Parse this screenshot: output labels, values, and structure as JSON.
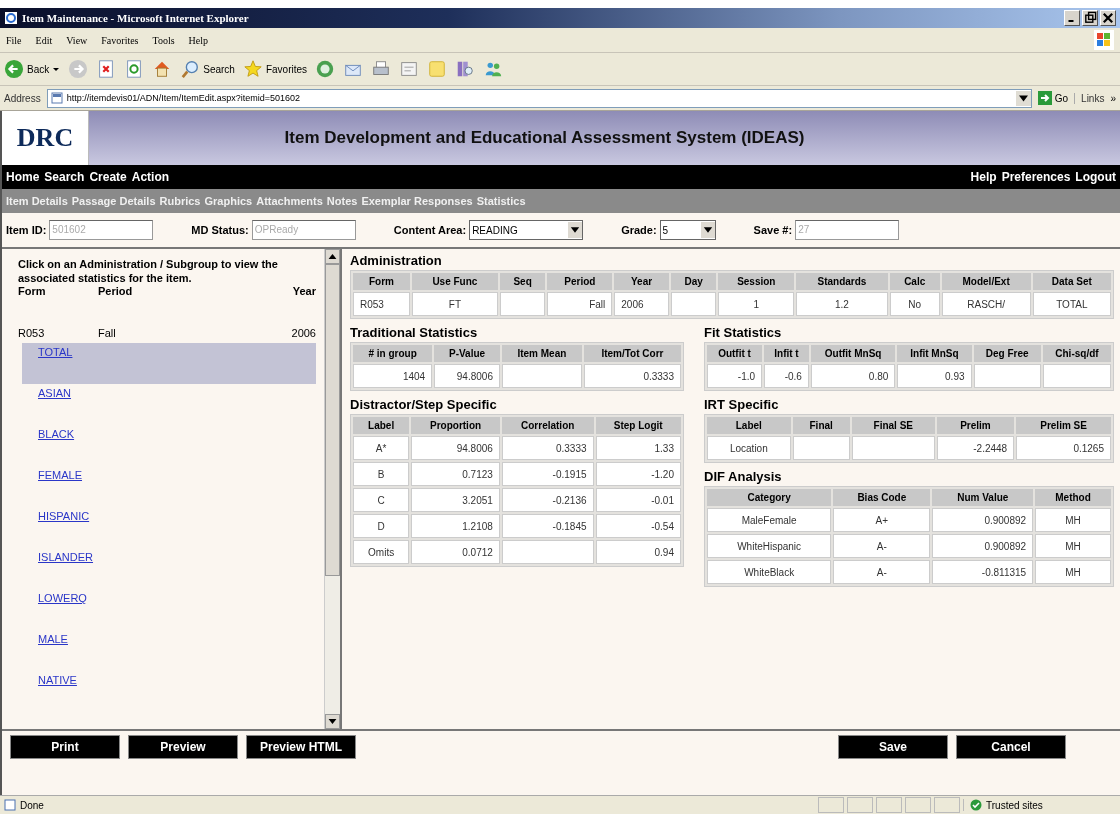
{
  "window": {
    "title": "Item Maintenance - Microsoft Internet Explorer"
  },
  "menu": [
    "File",
    "Edit",
    "View",
    "Favorites",
    "Tools",
    "Help"
  ],
  "toolbar": [
    {
      "kind": "back",
      "label": "Back"
    },
    {
      "kind": "forward"
    },
    {
      "kind": "stop"
    },
    {
      "kind": "refresh"
    },
    {
      "kind": "home"
    },
    {
      "kind": "search",
      "label": "Search"
    },
    {
      "kind": "favorites",
      "label": "Favorites"
    },
    {
      "kind": "media"
    },
    {
      "kind": "mail"
    },
    {
      "kind": "print"
    },
    {
      "kind": "edit"
    },
    {
      "kind": "notes"
    },
    {
      "kind": "research"
    },
    {
      "kind": "messenger"
    }
  ],
  "address": {
    "label": "Address",
    "value": "http://itemdevis01/ADN/Item/ItemEdit.aspx?itemid=501602",
    "go": "Go",
    "links": "Links",
    "more": "»"
  },
  "app": {
    "logo": "DRC",
    "title": "Item Development and Educational Assessment System (IDEAS)"
  },
  "nav_left": [
    "Home",
    "Search",
    "Create",
    "Action"
  ],
  "nav_right": [
    "Help",
    "Preferences",
    "Logout"
  ],
  "tabs": [
    "Item Details",
    "Passage Details",
    "Rubrics",
    "Graphics",
    "Attachments",
    "Notes",
    "Exemplar Responses",
    "Statistics"
  ],
  "fields": [
    {
      "label": "Item ID:",
      "value": "501602",
      "kind": "text",
      "disabled": true
    },
    {
      "label": "MD Status:",
      "value": "OPReady",
      "kind": "text",
      "disabled": true
    },
    {
      "label": "Content Area:",
      "value": "READING",
      "kind": "select"
    },
    {
      "label": "Grade:",
      "value": "5",
      "kind": "select"
    },
    {
      "label": "Save #:",
      "value": "27",
      "kind": "text",
      "disabled": true
    }
  ],
  "left_panel": {
    "instructions": "Click on an Administration / Subgroup to view the associated statistics for the item.",
    "columns": [
      "Form",
      "Period",
      "Year"
    ],
    "rows": [
      {
        "form": "R053",
        "period": "Fall",
        "year": "2006",
        "subgroups": [
          {
            "label": "TOTAL",
            "selected": true
          },
          {
            "label": "ASIAN",
            "selected": false
          },
          {
            "label": "BLACK",
            "selected": false
          },
          {
            "label": "FEMALE",
            "selected": false
          },
          {
            "label": "HISPANIC",
            "selected": false
          },
          {
            "label": "ISLANDER",
            "selected": false
          },
          {
            "label": "LOWERQ",
            "selected": false
          },
          {
            "label": "MALE",
            "selected": false
          },
          {
            "label": "NATIVE",
            "selected": false
          }
        ]
      }
    ]
  },
  "sections": [
    {
      "title": "Administration",
      "columns": [
        "Form",
        "Use Func",
        "Seq",
        "Period",
        "Year",
        "Day",
        "Session",
        "Standards",
        "Calc",
        "Model/Ext",
        "Data Set"
      ],
      "rows": [
        [
          "R053",
          "FT",
          "",
          "Fall",
          "2006",
          "",
          "1",
          "1.2",
          "No",
          "RASCH/",
          "TOTAL"
        ]
      ]
    },
    {
      "title": "Traditional Statistics",
      "columns": [
        "# in group",
        "P-Value",
        "Item Mean",
        "Item/Tot Corr"
      ],
      "rows": [
        [
          "1404",
          "94.8006",
          "",
          "0.3333"
        ]
      ]
    },
    {
      "title": "Fit Statistics",
      "columns": [
        "Outfit t",
        "Infit t",
        "Outfit MnSq",
        "Infit MnSq",
        "Deg Free",
        "Chi-sq/df"
      ],
      "rows": [
        [
          "-1.0",
          "-0.6",
          "0.80",
          "0.93",
          "",
          ""
        ]
      ]
    },
    {
      "title": "Distractor/Step Specific",
      "columns": [
        "Label",
        "Proportion",
        "Correlation",
        "Step Logit"
      ],
      "rows": [
        [
          "A*",
          "94.8006",
          "0.3333",
          "1.33"
        ],
        [
          "B",
          "0.7123",
          "-0.1915",
          "-1.20"
        ],
        [
          "C",
          "3.2051",
          "-0.2136",
          "-0.01"
        ],
        [
          "D",
          "1.2108",
          "-0.1845",
          "-0.54"
        ],
        [
          "Omits",
          "0.0712",
          "",
          "0.94"
        ]
      ]
    },
    {
      "title": "IRT Specific",
      "columns": [
        "Label",
        "Final",
        "Final SE",
        "Prelim",
        "Prelim SE"
      ],
      "rows": [
        [
          "Location",
          "",
          "",
          "-2.2448",
          "0.1265"
        ]
      ]
    },
    {
      "title": "DIF Analysis",
      "columns": [
        "Category",
        "Bias Code",
        "Num Value",
        "Method"
      ],
      "rows": [
        [
          "MaleFemale",
          "A+",
          "0.900892",
          "MH"
        ],
        [
          "WhiteHispanic",
          "A-",
          "0.900892",
          "MH"
        ],
        [
          "WhiteBlack",
          "A-",
          "-0.811315",
          "MH"
        ]
      ]
    }
  ],
  "buttons_left": [
    "Print",
    "Preview",
    "Preview HTML"
  ],
  "buttons_right": [
    "Save",
    "Cancel"
  ],
  "status": {
    "text": "Done",
    "zone": "Trusted sites"
  }
}
